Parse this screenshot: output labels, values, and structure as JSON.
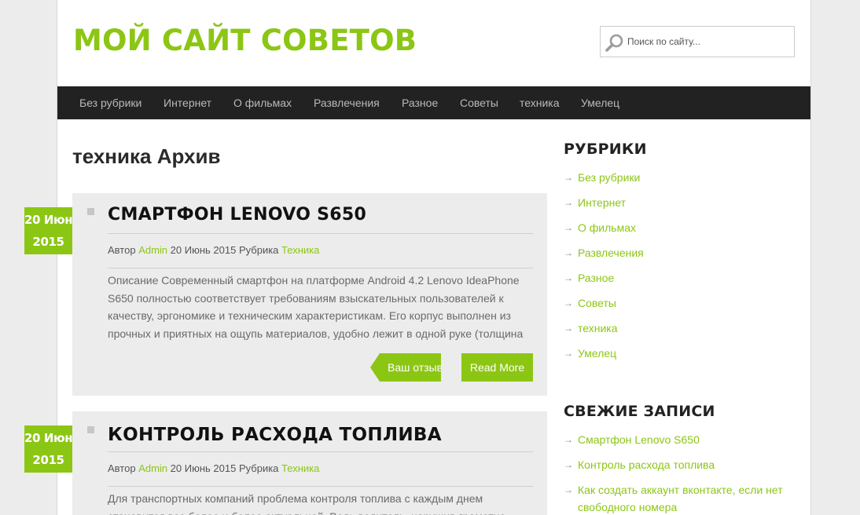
{
  "site": {
    "title": "МОЙ САЙТ СОВЕТОВ"
  },
  "search": {
    "placeholder": "Поиск по сайту..."
  },
  "nav": {
    "items": [
      "Без рубрики",
      "Интернет",
      "О фильмах",
      "Развлечения",
      "Разное",
      "Советы",
      "техника",
      "Умелец"
    ]
  },
  "archive": {
    "title": "техника Архив"
  },
  "posts": [
    {
      "date_day": "20 Июн",
      "date_year": "2015",
      "title": "СМАРТФОН LENOVO S650",
      "meta_author_label": "Автор",
      "meta_author": "Admin",
      "meta_date": "20 Июнь 2015",
      "meta_category_label": "Рубрика",
      "meta_category": "Техника",
      "excerpt": "Описание Современный смартфон на платформе Android 4.2 Lenovo IdeaPhone S650 полностью соответствует требованиям взыскательных пользователей к качеству, эргономике и техническим характеристикам. Его корпус выполнен из прочных и приятных на ощупь материалов, удобно лежит в одной руке (толщина",
      "comment_label": "Ваш отзыв",
      "more_label": "Read More"
    },
    {
      "date_day": "20 Июн",
      "date_year": "2015",
      "title": "КОНТРОЛЬ РАСХОДА ТОПЛИВА",
      "meta_author_label": "Автор",
      "meta_author": "Admin",
      "meta_date": "20 Июнь 2015",
      "meta_category_label": "Рубрика",
      "meta_category": "Техника",
      "excerpt": "Для транспортных компаний проблема контроля топлива с каждым днем становится все более и более актуальной. Ведь водитель, нарушив грамотно"
    }
  ],
  "sidebar": {
    "categories_title": "РУБРИКИ",
    "categories": [
      "Без рубрики",
      "Интернет",
      "О фильмах",
      "Развлечения",
      "Разное",
      "Советы",
      "техника",
      "Умелец"
    ],
    "recent_title": "СВЕЖИЕ ЗАПИСИ",
    "recent": [
      "Смартфон Lenovo S650",
      "Контроль расхода топлива",
      "Как создать аккаунт вконтакте, если нет свободного номера"
    ]
  },
  "colors": {
    "accent": "#8cc614",
    "nav_bg": "#222222",
    "post_bg": "#ececec"
  },
  "icons": {
    "search": "search-icon",
    "bullet": "arrow-right-icon"
  }
}
